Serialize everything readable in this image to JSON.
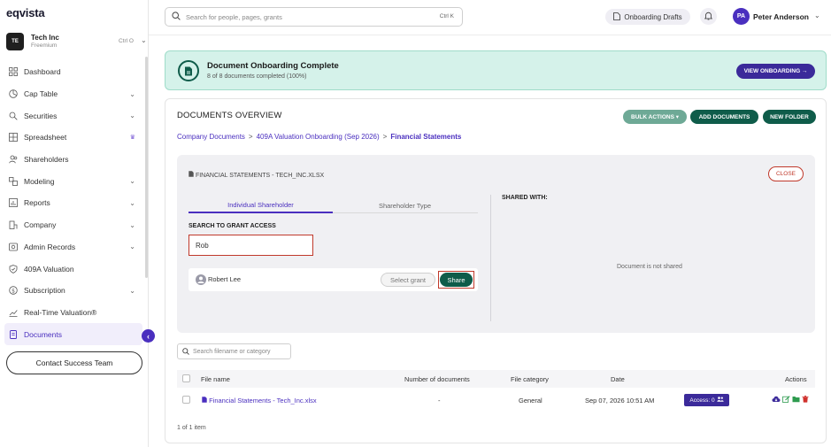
{
  "app": {
    "logo": "eqvista"
  },
  "company": {
    "initials": "TE",
    "name": "Tech Inc",
    "plan": "Freemium",
    "shortcut": "Ctrl O"
  },
  "sidebar": {
    "items": [
      {
        "label": "Dashboard",
        "icon": "dashboard-icon",
        "has_chevron": false
      },
      {
        "label": "Cap Table",
        "icon": "pie-icon",
        "has_chevron": true
      },
      {
        "label": "Securities",
        "icon": "securities-icon",
        "has_chevron": true
      },
      {
        "label": "Spreadsheet",
        "icon": "grid-icon",
        "has_chevron": false,
        "crown": true
      },
      {
        "label": "Shareholders",
        "icon": "users-icon",
        "has_chevron": false
      },
      {
        "label": "Modeling",
        "icon": "modeling-icon",
        "has_chevron": true
      },
      {
        "label": "Reports",
        "icon": "reports-icon",
        "has_chevron": true
      },
      {
        "label": "Company",
        "icon": "company-icon",
        "has_chevron": true
      },
      {
        "label": "Admin Records",
        "icon": "records-icon",
        "has_chevron": true
      },
      {
        "label": "409A Valuation",
        "icon": "shield-icon",
        "has_chevron": false
      },
      {
        "label": "Subscription",
        "icon": "dollar-icon",
        "has_chevron": true
      },
      {
        "label": "Real-Time Valuation®",
        "icon": "chart-line-icon",
        "has_chevron": false
      },
      {
        "label": "Documents",
        "icon": "documents-icon",
        "has_chevron": false,
        "active": true
      }
    ],
    "contact_label": "Contact Success Team"
  },
  "topbar": {
    "search_placeholder": "Search for people, pages, grants",
    "search_shortcut": "Ctrl K",
    "drafts_label": "Onboarding Drafts",
    "user_initials": "PA",
    "user_name": "Peter Anderson"
  },
  "banner": {
    "title": "Document Onboarding Complete",
    "subtitle": "8 of 8 documents completed (100%)",
    "button": "VIEW ONBOARDING →"
  },
  "documents": {
    "title": "DOCUMENTS OVERVIEW",
    "bulk_actions": "BULK ACTIONS ▾",
    "add_documents": "ADD DOCUMENTS",
    "new_folder": "NEW FOLDER",
    "breadcrumb": [
      "Company Documents",
      "409A Valuation Onboarding (Sep 2026)",
      "Financial Statements"
    ]
  },
  "share_panel": {
    "file_name": "FINANCIAL STATEMENTS - TECH_INC.XLSX",
    "close": "CLOSE",
    "tabs": [
      "Individual Shareholder",
      "Shareholder Type"
    ],
    "search_label": "SEARCH TO GRANT ACCESS",
    "search_value": "Rob",
    "result": {
      "name": "Robert Lee",
      "grant_placeholder": "Select grant",
      "share": "Share"
    },
    "shared_with_label": "SHARED WITH:",
    "not_shared_text": "Document is not shared"
  },
  "table": {
    "search_placeholder": "Search filename or category",
    "headers": [
      "File name",
      "Number of documents",
      "File category",
      "Date",
      "Actions"
    ],
    "rows": [
      {
        "file_name": "Financial Statements - Tech_Inc.xlsx",
        "count": "-",
        "category": "General",
        "date": "Sep 07, 2026 10:51 AM",
        "access": "Access: 0"
      }
    ],
    "pager": "1 of 1 item"
  },
  "colors": {
    "brand_purple": "#4a2fbf",
    "dark_green": "#0f5c4a",
    "highlight_red": "#c0392b",
    "banner_bg": "#d5f2ea"
  }
}
